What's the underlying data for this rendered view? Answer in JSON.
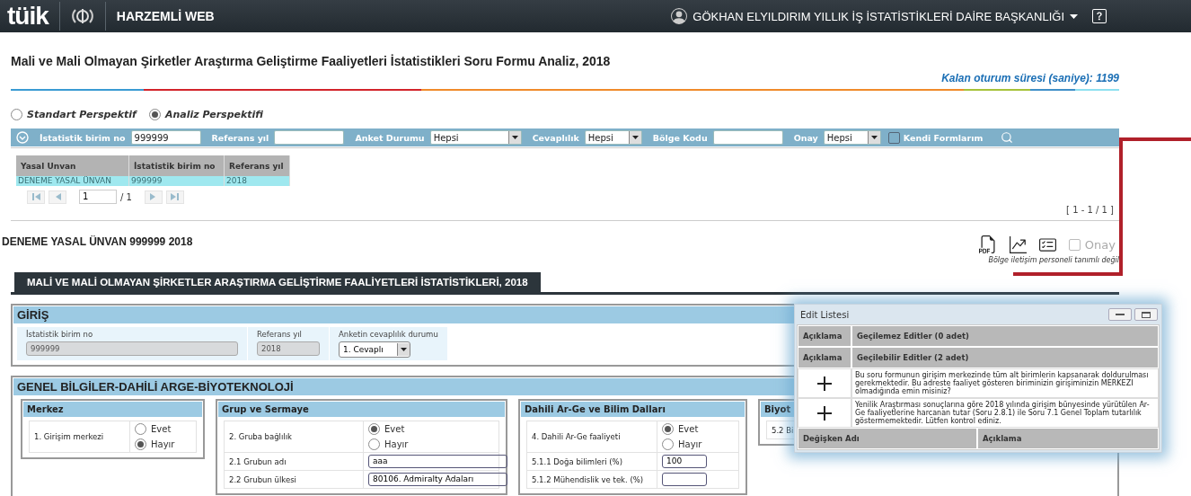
{
  "header": {
    "logo": "tüik",
    "app_title": "HARZEMLİ WEB",
    "user": "GÖKHAN ELYILDIRIM YILLIK İŞ İSTATİSTİKLERİ DAİRE BAŞKANLIĞI"
  },
  "page": {
    "title": "Mali ve Mali Olmayan Şirketler Araştırma Geliştirme Faaliyetleri İstatistikleri Soru Formu Analiz, 2018",
    "session": "Kalan oturum süresi (saniye): 1199"
  },
  "perspectives": [
    {
      "label": "Standart Perspektif",
      "selected": false
    },
    {
      "label": "Analiz Perspektifi",
      "selected": true
    }
  ],
  "filters": [
    {
      "kind": "text",
      "label": "İstatistik birim no",
      "value": "999999"
    },
    {
      "kind": "text",
      "label": "Referans yıl"
    },
    {
      "kind": "select",
      "label": "Anket Durumu",
      "value": "Hepsi"
    },
    {
      "kind": "select",
      "label": "Cevaplılık",
      "value": "Hepsi"
    },
    {
      "kind": "text",
      "label": "Bölge Kodu"
    },
    {
      "kind": "select",
      "label": "Onay",
      "value": "Hepsi"
    },
    {
      "kind": "checkbox",
      "label": "Kendi Formlarım",
      "checked": false
    }
  ],
  "results": {
    "columns": [
      "Yasal Unvan",
      "İstatistik birim no",
      "Referans yıl"
    ],
    "rows": [
      {
        "cells": [
          "DENEME YASAL ÜNVAN",
          "999999",
          "2018"
        ],
        "selected": true
      }
    ],
    "page": "1",
    "page_total": "/ 1",
    "range": "[ 1 - 1 / 1 ]"
  },
  "record": {
    "title": "DENEME YASAL ÜNVAN 999999 2018",
    "approve_label": "Onay",
    "approved": false,
    "note": "Bölge iletişim personeli tanımlı değil"
  },
  "form_tab": "MALİ VE MALİ OLMAYAN ŞİRKETLER ARAŞTIRMA GELİŞTİRME FAALİYETLERİ İSTATİSTİKLERİ, 2018",
  "intro": {
    "title": "GİRİŞ",
    "fields": [
      {
        "kind": "readonly",
        "label": "İstatistik birim no",
        "value": "999999"
      },
      {
        "kind": "readonly",
        "label": "Referans yıl",
        "value": "2018"
      },
      {
        "kind": "select",
        "label": "Anketin cevaplılık durumu",
        "value": "1. Cevaplı"
      }
    ]
  },
  "general": {
    "title": "GENEL BİLGİLER-DAHİLİ ARGE-BİYOTEKNOLOJİ",
    "panels": [
      {
        "title": "Merkez",
        "rows": [
          {
            "kind": "radio",
            "label": "1. Girişim merkezi",
            "options": [
              {
                "label": "Evet",
                "selected": false
              },
              {
                "label": "Hayır",
                "selected": true
              }
            ]
          }
        ]
      },
      {
        "title": "Grup ve Sermaye",
        "rows": [
          {
            "kind": "radio",
            "label": "2. Gruba bağlılık",
            "options": [
              {
                "label": "Evet",
                "selected": true
              },
              {
                "label": "Hayır",
                "selected": false
              }
            ]
          },
          {
            "kind": "text",
            "label": "2.1 Grubun adı",
            "value": "aaa"
          },
          {
            "kind": "text",
            "label": "2.2 Grubun ülkesi",
            "value": "80106. Admiralty Adaları"
          }
        ]
      },
      {
        "title": "Dahili Ar-Ge ve Bilim Dalları",
        "rows": [
          {
            "kind": "radio",
            "label": "4. Dahili Ar-Ge faaliyeti",
            "options": [
              {
                "label": "Evet",
                "selected": true
              },
              {
                "label": "Hayır",
                "selected": false
              }
            ]
          },
          {
            "kind": "text",
            "label": "5.1.1 Doğa bilimleri (%)",
            "value": "100"
          },
          {
            "kind": "text",
            "label": "5.1.2 Mühendislik ve tek. (%)"
          }
        ]
      },
      {
        "title": "Biyot",
        "rows": [
          {
            "kind": "label",
            "label": "5.2 Bi"
          }
        ]
      }
    ]
  },
  "dialog": {
    "title": "Edit Listesi",
    "groups": [
      {
        "label": "Açıklama",
        "title": "Geçilemez Editler (0 adet)"
      },
      {
        "label": "Açıklama",
        "title": "Geçilebilir Editler (2 adet)"
      }
    ],
    "edits": [
      "Bu soru formunun girişim merkezinde tüm alt birimlerin kapsanarak doldurulması gerekmektedir. Bu adreste faaliyet gösteren biriminizin girişiminizin MERKEZI olmadığında emin misiniz?",
      "Yenilik Araştırması sonuçlarına göre 2018 yılında girişim bünyesinde yürütülen Ar-Ge faaliyetlerine harcanan tutar (Soru 2.8.1) ile Soru 7.1 Genel Toplam tutarlılık göstermemektedir. Lütfen kontrol ediniz."
    ],
    "columns": [
      "Değişken Adı",
      "Açıklama"
    ]
  }
}
